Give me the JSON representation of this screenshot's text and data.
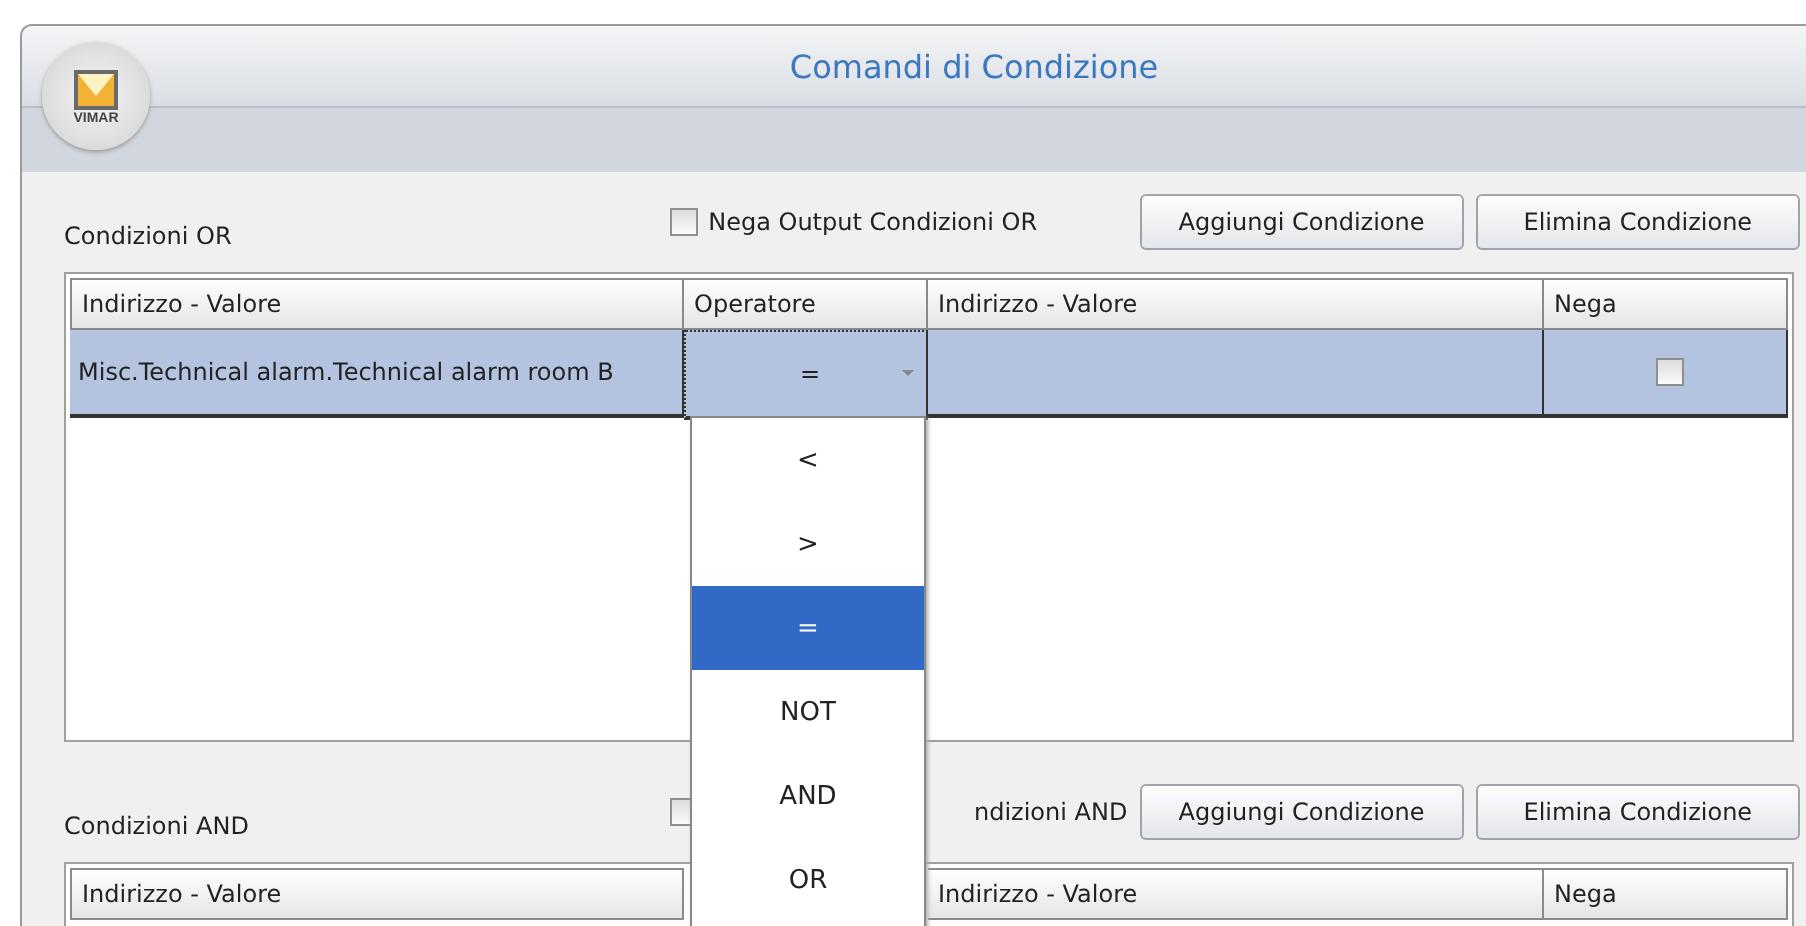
{
  "window": {
    "title": "Comandi di Condizione",
    "logo_text": "VIMAR"
  },
  "sections": [
    {
      "label": "Condizioni OR",
      "negate_output": {
        "label": "Nega Output Condizioni OR",
        "checked": false
      },
      "buttons": [
        "Aggiungi Condizione",
        "Elimina Condizione"
      ],
      "table": {
        "columns": [
          {
            "kind": "address",
            "label": "Indirizzo - Valore"
          },
          {
            "kind": "operator",
            "label": "Operatore"
          },
          {
            "kind": "value",
            "label": "Indirizzo - Valore"
          },
          {
            "kind": "negate",
            "label": "Nega"
          }
        ],
        "rows": [
          {
            "selected": true,
            "address": "Misc.Technical alarm.Technical alarm room B",
            "operator": "=",
            "negate": false
          }
        ]
      }
    },
    {
      "label": "Condizioni AND",
      "negate_output": {
        "label": "ndizioni AND",
        "checked": false
      },
      "buttons": [
        "Aggiungi Condizione",
        "Elimina Condizione"
      ],
      "table": {
        "columns": [
          {
            "kind": "address",
            "label": "Indirizzo - Valore"
          },
          {
            "kind": "value",
            "label": "Indirizzo - Valore"
          },
          {
            "kind": "negate",
            "label": "Nega"
          }
        ]
      }
    }
  ],
  "operator_dropdown": {
    "options": [
      {
        "label": "<",
        "selected": false
      },
      {
        "label": ">",
        "selected": false
      },
      {
        "label": "=",
        "selected": true
      },
      {
        "label": "NOT",
        "selected": false
      },
      {
        "label": "AND",
        "selected": false
      },
      {
        "label": "OR",
        "selected": false
      }
    ]
  }
}
